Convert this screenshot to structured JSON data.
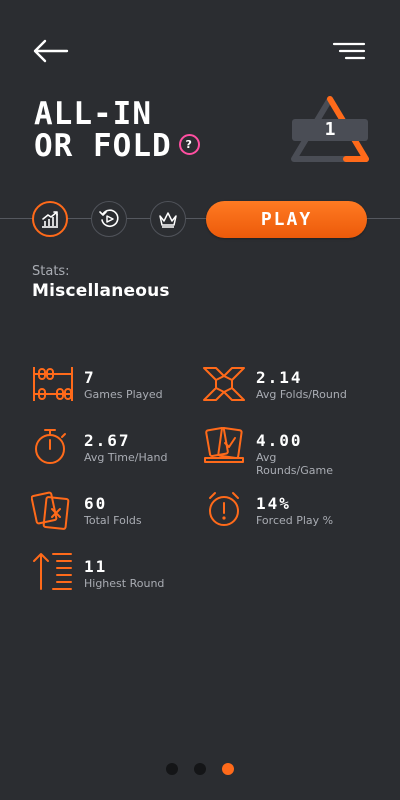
{
  "header": {
    "title_line1": "ALL-IN",
    "title_line2": "OR FOLD",
    "help_label": "?",
    "level": "1"
  },
  "tabs": [
    {
      "name": "stats",
      "icon": "chart-icon",
      "active": true
    },
    {
      "name": "replay",
      "icon": "replay-icon",
      "active": false
    },
    {
      "name": "leaderboard",
      "icon": "crown-icon",
      "active": false
    }
  ],
  "play_label": "PLAY",
  "stats": {
    "label": "Stats:",
    "section": "Miscellaneous",
    "items": [
      {
        "value": "7",
        "label": "Games Played",
        "icon": "abacus-icon"
      },
      {
        "value": "2.14",
        "label": "Avg Folds/Round",
        "icon": "cross-icon"
      },
      {
        "value": "2.67",
        "label": "Avg Time/Hand",
        "icon": "stopwatch-icon"
      },
      {
        "value": "4.00",
        "label": "Avg Rounds/Game",
        "icon": "cards-check-icon"
      },
      {
        "value": "60",
        "label": "Total Folds",
        "icon": "folded-cards-icon"
      },
      {
        "value": "14%",
        "label": "Forced Play %",
        "icon": "alarm-icon"
      },
      {
        "value": "11",
        "label": "Highest Round",
        "icon": "round-up-icon"
      }
    ]
  },
  "pagination": {
    "total": 3,
    "active": 3
  },
  "colors": {
    "accent": "#ff6a1a",
    "background": "#2b2d31",
    "pink": "#ff4fa1"
  }
}
